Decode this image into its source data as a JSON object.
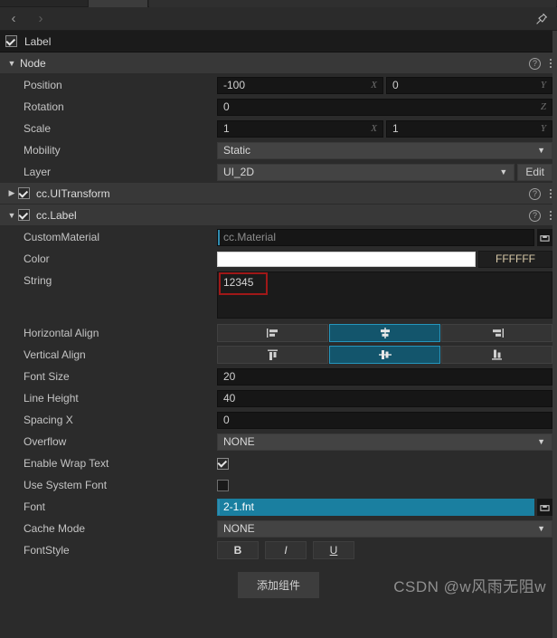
{
  "window": {
    "nav_back": "‹",
    "nav_forward": "›",
    "pin_icon": "pin-icon"
  },
  "node": {
    "name": "Label",
    "enabled": true
  },
  "sections": [
    {
      "key": "node",
      "title": "Node",
      "expanded": true,
      "has_checkbox": false
    },
    {
      "key": "uitransform",
      "title": "cc.UITransform",
      "expanded": false,
      "has_checkbox": true,
      "checked": true
    },
    {
      "key": "label",
      "title": "cc.Label",
      "expanded": true,
      "has_checkbox": true,
      "checked": true
    }
  ],
  "node_props": {
    "position": {
      "label": "Position",
      "x": "-100",
      "y": "0",
      "axis_x": "X",
      "axis_y": "Y"
    },
    "rotation": {
      "label": "Rotation",
      "z": "0",
      "axis_z": "Z"
    },
    "scale": {
      "label": "Scale",
      "x": "1",
      "y": "1",
      "axis_x": "X",
      "axis_y": "Y"
    },
    "mobility": {
      "label": "Mobility",
      "value": "Static"
    },
    "layer": {
      "label": "Layer",
      "value": "UI_2D",
      "edit_label": "Edit"
    }
  },
  "label_props": {
    "custom_material": {
      "label": "CustomMaterial",
      "placeholder": "cc.Material",
      "value": ""
    },
    "color": {
      "label": "Color",
      "hex": "FFFFFF",
      "swatch": "#FFFFFF"
    },
    "string": {
      "label": "String",
      "value": "12345"
    },
    "horizontal_align": {
      "label": "Horizontal Align",
      "options": [
        "left",
        "center",
        "right"
      ],
      "selected": 1
    },
    "vertical_align": {
      "label": "Vertical Align",
      "options": [
        "top",
        "center",
        "bottom"
      ],
      "selected": 1
    },
    "font_size": {
      "label": "Font Size",
      "value": "20"
    },
    "line_height": {
      "label": "Line Height",
      "value": "40"
    },
    "spacing_x": {
      "label": "Spacing X",
      "value": "0"
    },
    "overflow": {
      "label": "Overflow",
      "value": "NONE"
    },
    "enable_wrap_text": {
      "label": "Enable Wrap Text",
      "checked": true
    },
    "use_system_font": {
      "label": "Use System Font",
      "checked": false
    },
    "font": {
      "label": "Font",
      "value": "2-1.fnt",
      "selected": true
    },
    "cache_mode": {
      "label": "Cache Mode",
      "value": "NONE"
    },
    "font_style": {
      "label": "FontStyle",
      "bold": "B",
      "italic": "I",
      "underline": "U"
    }
  },
  "footer": {
    "add_component": "添加组件",
    "watermark": "CSDN @w风雨无阻w"
  },
  "colors": {
    "accent": "#1a7fa0",
    "active_segment": "#13556c",
    "highlight_box": "#a01818",
    "panel_bg": "#2b2b2b"
  }
}
